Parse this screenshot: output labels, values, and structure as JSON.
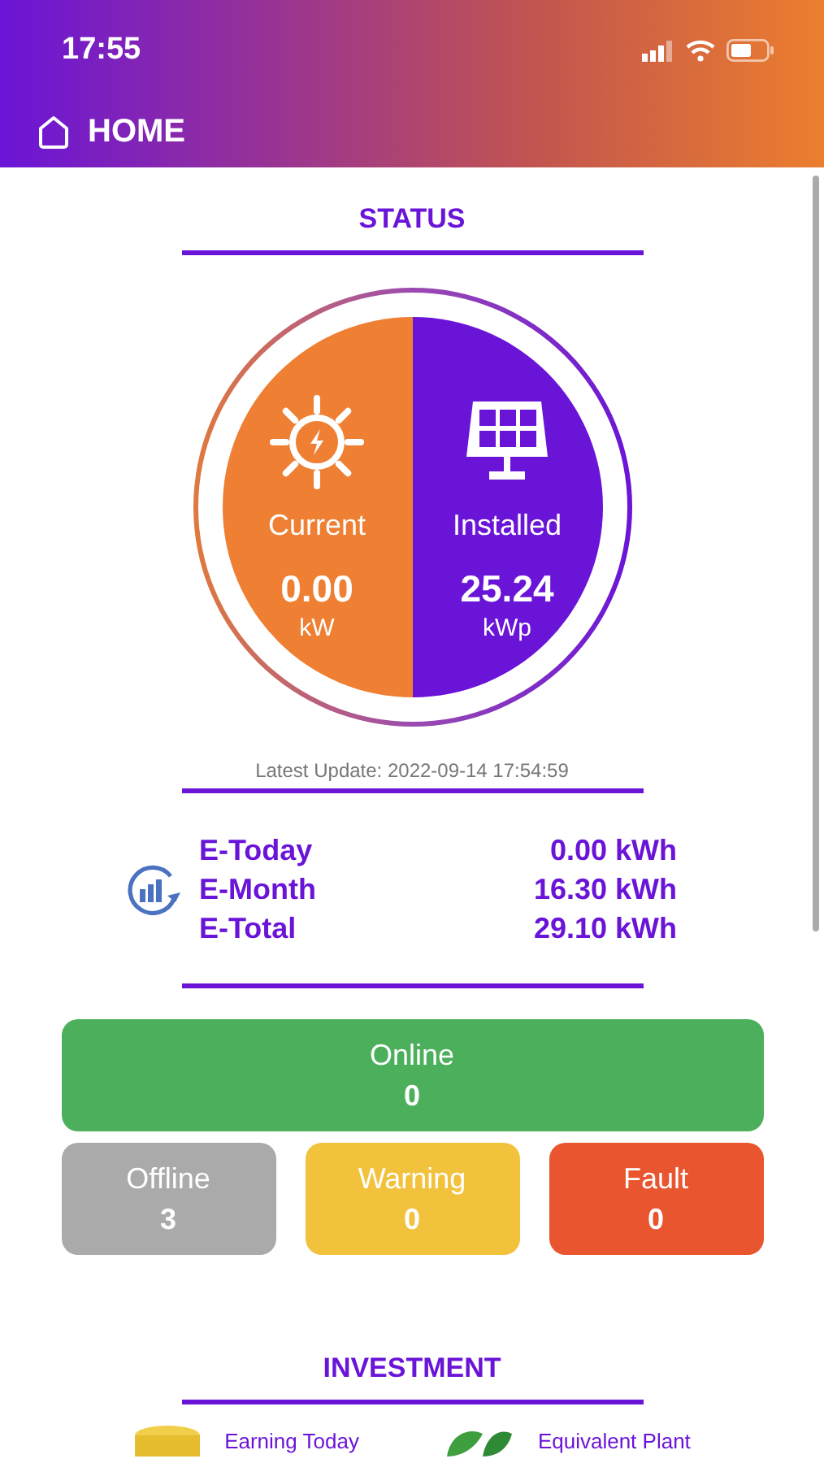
{
  "status_bar": {
    "time": "17:55"
  },
  "header": {
    "title": "HOME"
  },
  "status": {
    "title": "STATUS",
    "halves": [
      {
        "kind": "current",
        "label": "Current",
        "value": "0.00",
        "unit": "kW"
      },
      {
        "kind": "installed",
        "label": "Installed",
        "value": "25.24",
        "unit": "kWp"
      }
    ],
    "latest_update": "Latest Update: 2022-09-14 17:54:59",
    "energy": [
      {
        "label": "E-Today",
        "value": "0.00 kWh"
      },
      {
        "label": "E-Month",
        "value": "16.30 kWh"
      },
      {
        "label": "E-Total",
        "value": "29.10 kWh"
      }
    ]
  },
  "devices": [
    {
      "label": "Online",
      "count": "0",
      "color": "#4caf5c"
    },
    {
      "label": "Offline",
      "count": "3",
      "color": "#aaaaaa"
    },
    {
      "label": "Warning",
      "count": "0",
      "color": "#f2c23d"
    },
    {
      "label": "Fault",
      "count": "0",
      "color": "#e8552f"
    }
  ],
  "investment": {
    "title": "INVESTMENT",
    "items": [
      {
        "kind": "coin",
        "label": "Earning Today"
      },
      {
        "kind": "plant",
        "label": "Equivalent Plant"
      }
    ]
  }
}
